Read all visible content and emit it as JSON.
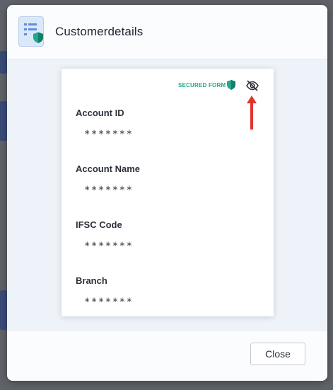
{
  "modal": {
    "title": "Customerdetails",
    "icon": "form-shield-icon"
  },
  "form": {
    "secured_label": "SECURED FORM",
    "secured_icon": "shield-icon",
    "visibility_toggle_icon": "eye-slash-icon",
    "annotation": "red-arrow-pointing-up",
    "fields": [
      {
        "label": "Account ID",
        "value": "*******"
      },
      {
        "label": "Account Name",
        "value": "*******"
      },
      {
        "label": "IFSC Code",
        "value": "*******"
      },
      {
        "label": "Branch",
        "value": "*******"
      }
    ]
  },
  "footer": {
    "close_label": "Close"
  },
  "colors": {
    "accent_green": "#1fa98d",
    "annotation_red": "#e5322d",
    "modal_bg": "#eef2f9"
  }
}
